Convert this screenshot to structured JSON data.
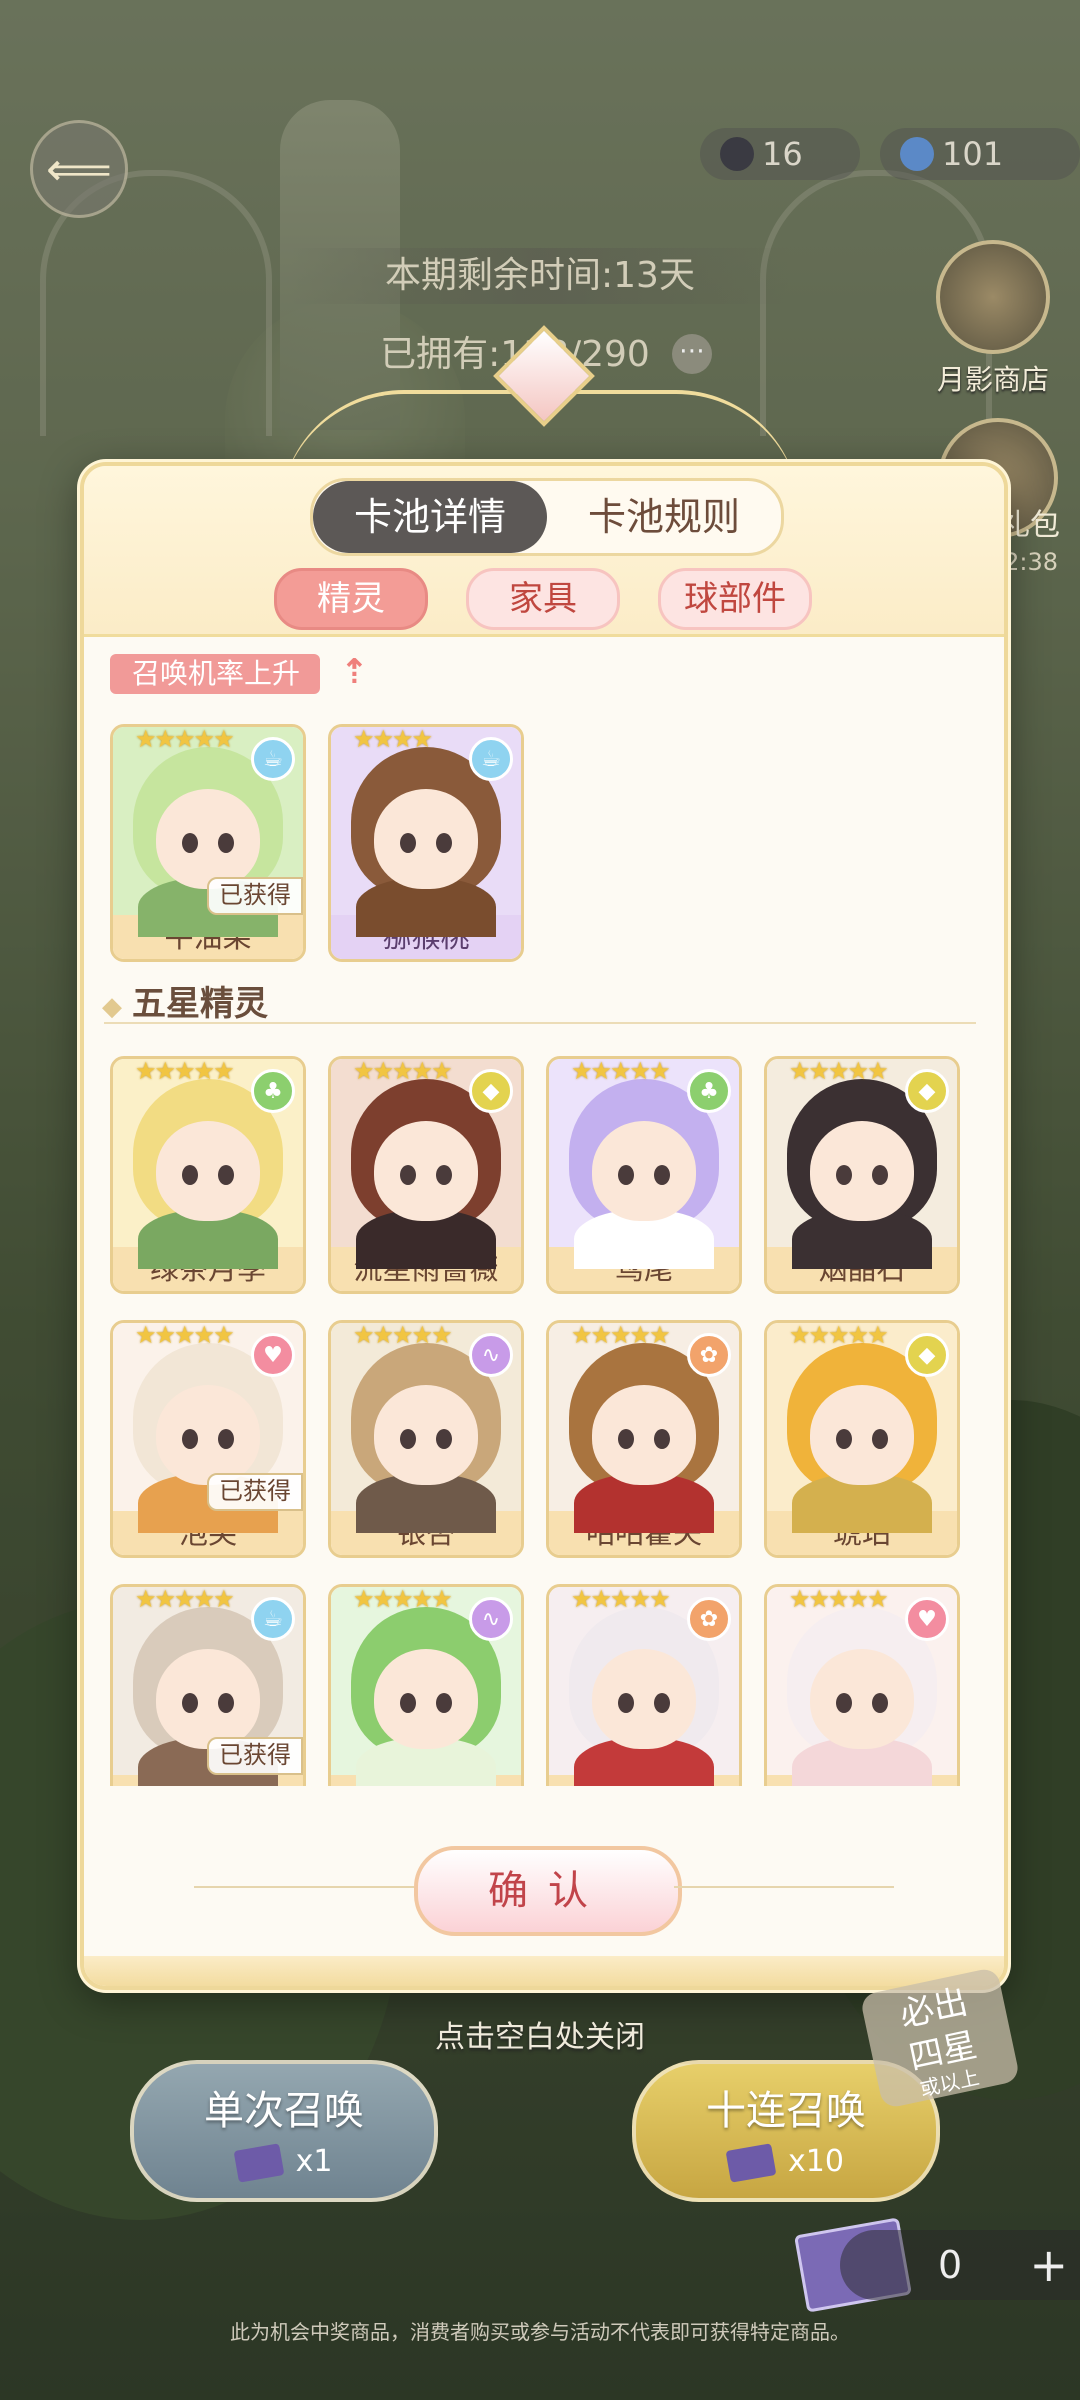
{
  "hud": {
    "moon_coin": "16",
    "crystal": "101",
    "back_icon": "back-arrow-icon"
  },
  "pool": {
    "time_left": "本期剩余时间:13天",
    "owned": "已拥有:138/290"
  },
  "side": {
    "shop_label": "月影商店",
    "gift_label": "礼包",
    "gift_time": "2:38"
  },
  "modal": {
    "tabs": [
      "卡池详情",
      "卡池规则"
    ],
    "active_tab": 0,
    "sub_tabs": [
      "精灵",
      "家具",
      "球部件"
    ],
    "active_sub_tab": 0,
    "rate_up_label": "召唤机率上升",
    "section_title": "五星精灵",
    "obtained_label": "已获得",
    "confirm_label": "确认",
    "rate_up": [
      {
        "name": "牛油果",
        "element": "cup",
        "obtained": true,
        "stars": 5,
        "theme": "green"
      },
      {
        "name": "猕猴桃",
        "element": "cup",
        "obtained": false,
        "stars": 4,
        "theme": "purple"
      }
    ],
    "five_star": [
      {
        "name": "绿茶月季",
        "element": "clover",
        "obtained": false
      },
      {
        "name": "流星雨蔷薇",
        "element": "diamond",
        "obtained": false
      },
      {
        "name": "鸢尾",
        "element": "clover",
        "obtained": false
      },
      {
        "name": "烟晶石",
        "element": "diamond",
        "obtained": false
      },
      {
        "name": "泡芙",
        "element": "heart",
        "obtained": true
      },
      {
        "name": "银杏",
        "element": "swan",
        "obtained": false
      },
      {
        "name": "咕咕霍夫",
        "element": "flower",
        "obtained": false
      },
      {
        "name": "琥珀",
        "element": "diamond",
        "obtained": false
      },
      {
        "name": "",
        "element": "cup",
        "obtained": true
      },
      {
        "name": "",
        "element": "swan",
        "obtained": false
      },
      {
        "name": "",
        "element": "flower",
        "obtained": false
      },
      {
        "name": "",
        "element": "heart",
        "obtained": false
      }
    ]
  },
  "close_hint": "点击空白处关闭",
  "summon": {
    "single_label": "单次召唤",
    "single_cost": "x1",
    "ten_label": "十连召唤",
    "ten_cost": "x10",
    "guarantee_line1": "必出",
    "guarantee_line2": "四星",
    "guarantee_line3": "或以上"
  },
  "tickets": {
    "count": "0",
    "plus": "+"
  },
  "disclaimer": "此为机会中奖商品，消费者购买或参与活动不代表即可获得特定商品。",
  "colors": {
    "modal_bg": "#fdfaf3",
    "accent_pink": "#f39c96",
    "gold_border": "#e8cd8f",
    "elements": {
      "cup": "#8fd3f0",
      "clover": "#8ccf6e",
      "diamond": "#e3d34f",
      "heart": "#f38da0",
      "swan": "#c89be8",
      "flower": "#f2a36b"
    },
    "element_glyphs": {
      "cup": "☕",
      "clover": "♣",
      "diamond": "◆",
      "heart": "♥",
      "swan": "∿",
      "flower": "✿"
    }
  }
}
